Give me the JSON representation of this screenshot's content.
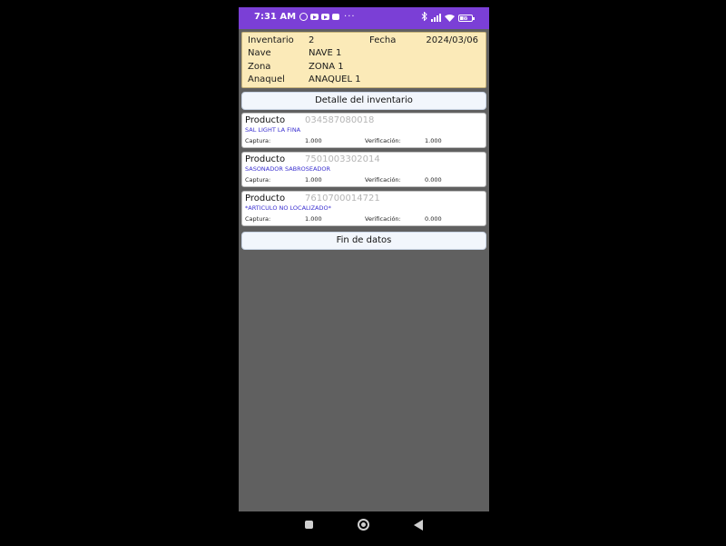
{
  "status_bar": {
    "time": "7:31 AM",
    "more": "···",
    "battery": "86"
  },
  "header": {
    "inventario_label": "Inventario",
    "inventario_value": "2",
    "fecha_label": "Fecha",
    "fecha_value": "2024/03/06",
    "nave_label": "Nave",
    "nave_value": "NAVE 1",
    "zona_label": "Zona",
    "zona_value": "ZONA 1",
    "anaquel_label": "Anaquel",
    "anaquel_value": "ANAQUEL 1"
  },
  "detail_button": "Detalle del inventario",
  "items": [
    {
      "label": "Producto",
      "code": "034587080018",
      "description": "SAL LIGHT LA FINA",
      "captura_label": "Captura:",
      "captura_value": "1.000",
      "verificacion_label": "Verificación:",
      "verificacion_value": "1.000"
    },
    {
      "label": "Producto",
      "code": "7501003302014",
      "description": "SASONADOR SABROSEADOR",
      "captura_label": "Captura:",
      "captura_value": "1.000",
      "verificacion_label": "Verificación:",
      "verificacion_value": "0.000"
    },
    {
      "label": "Producto",
      "code": "7610700014721",
      "description": "*ARTICULO NO LOCALIZADO*",
      "captura_label": "Captura:",
      "captura_value": "1.000",
      "verificacion_label": "Verificación:",
      "verificacion_value": "0.000"
    }
  ],
  "end_button": "Fin de datos",
  "colors": {
    "status_bar": "#7b3fd6",
    "header_bg": "#fbeab8",
    "description_text": "#3a2fd0",
    "screen_bg": "#606060"
  },
  "icons": {
    "status_left": [
      "settings-icon",
      "youtube-icon",
      "youtube-icon",
      "message-icon"
    ],
    "status_right": [
      "bluetooth-icon",
      "signal-icon",
      "wifi-icon",
      "battery-icon"
    ],
    "nav": [
      "recents-icon",
      "home-icon",
      "back-icon"
    ]
  }
}
